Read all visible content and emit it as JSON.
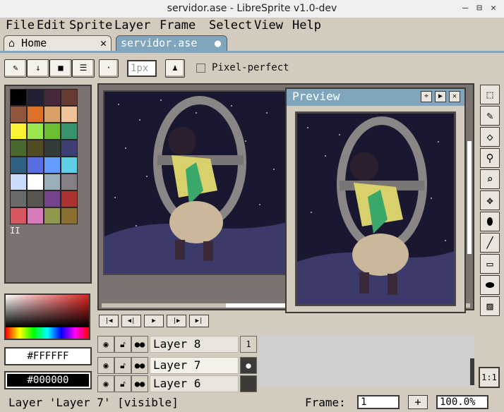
{
  "window": {
    "title": "servidor.ase - LibreSprite v1.0-dev",
    "minimize": "–",
    "maximize": "⊟",
    "close": "✕"
  },
  "menu": [
    "File",
    "Edit",
    "Sprite",
    "Layer",
    "Frame",
    "Select",
    "View",
    "Help"
  ],
  "tabs": [
    {
      "label": "Home",
      "close": "✕"
    },
    {
      "label": "servidor.ase",
      "modified": "●"
    }
  ],
  "toolbar": {
    "brush_size_placeholder": "1px",
    "pixel_perfect_label": "Pixel-perfect",
    "pixel_perfect_checked": false
  },
  "palette": {
    "colors": [
      "#000000",
      "#222034",
      "#45283c",
      "#663931",
      "#8f563b",
      "#df7126",
      "#d9a066",
      "#eec39a",
      "#fbf236",
      "#99e550",
      "#6abe30",
      "#37946e",
      "#4b692f",
      "#524b24",
      "#323c39",
      "#3f3f74",
      "#306082",
      "#5b6ee1",
      "#639bff",
      "#5fcde4",
      "#cbdbfc",
      "#ffffff",
      "#9badb7",
      "#847e87",
      "#696a6a",
      "#595652",
      "#76428a",
      "#ac3232",
      "#d95763",
      "#d77bba",
      "#8f974a",
      "#8a6f30"
    ],
    "pause_glyph": "II"
  },
  "colors": {
    "foreground": "#FFFFFF",
    "background": "#000000"
  },
  "preview": {
    "title": "Preview"
  },
  "animation_controls": [
    "first-frame",
    "previous-frame",
    "play",
    "next-frame",
    "last-frame"
  ],
  "layers": [
    {
      "name": "Layer 8",
      "cel": ""
    },
    {
      "name": "Layer 7",
      "cel": "●"
    },
    {
      "name": "Layer 6",
      "cel": ""
    }
  ],
  "timeline": {
    "frame_header": "1"
  },
  "zoom_button": "1:1",
  "status": {
    "text": "Layer 'Layer 7' [visible]",
    "frame_label": "Frame:",
    "frame_value": "1",
    "add_frame": "+",
    "zoom": "100.0%"
  },
  "theme": {
    "accent": "#7fa6bd",
    "panel": "#d3cbbe",
    "dark_panel": "#7b7370"
  }
}
